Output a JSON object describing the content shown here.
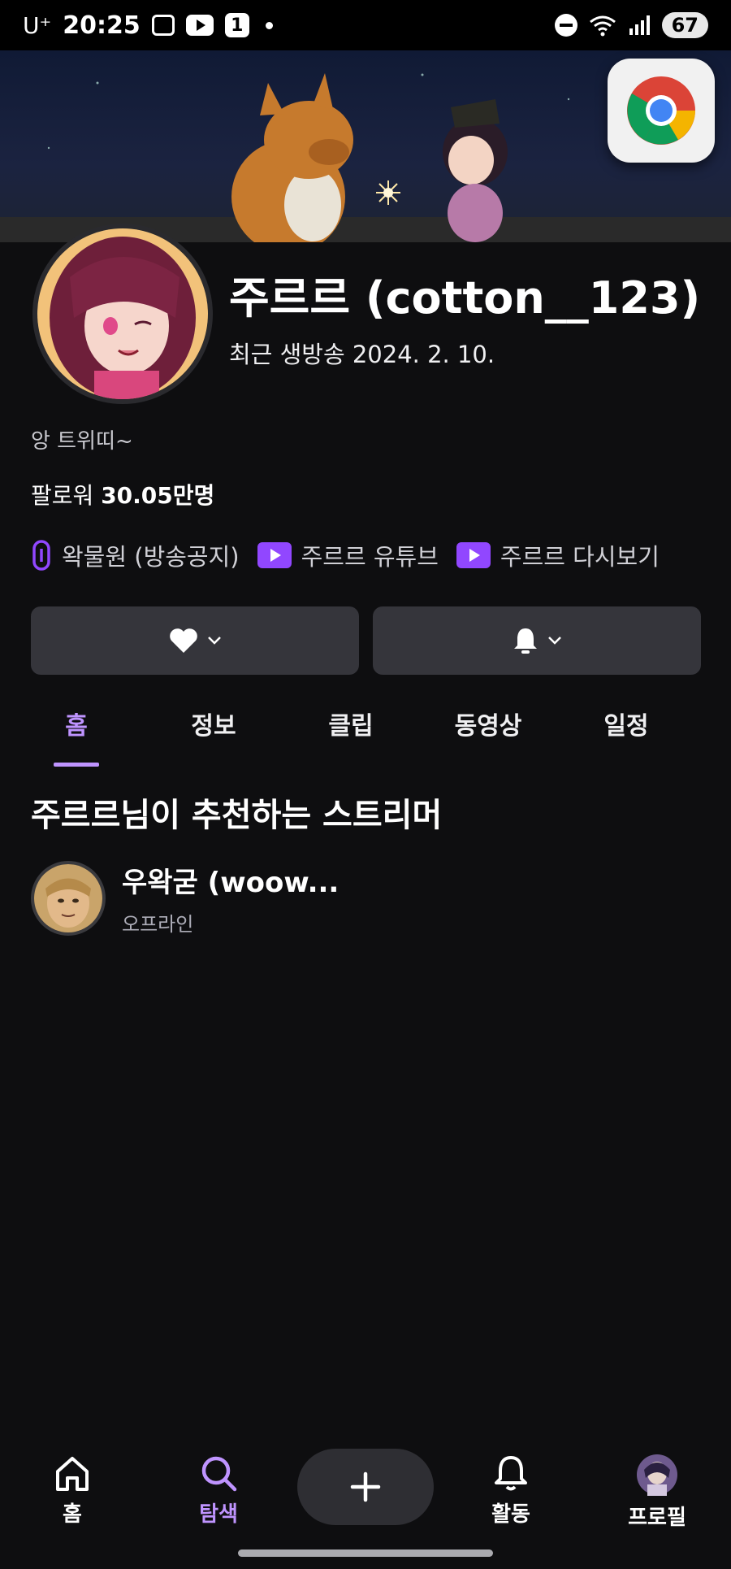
{
  "status_bar": {
    "carrier": "U⁺",
    "time": "20:25",
    "notification_count": "1",
    "battery": "67"
  },
  "profile": {
    "title": "주르르 (cotton__123)",
    "recent_broadcast": "최근 생방송 2024. 2. 10.",
    "bio": "앙 트위띠~",
    "followers_label": "팔로워",
    "followers_count": "30.05만명"
  },
  "links": [
    {
      "label": "왁물원 (방송공지)",
      "icon": "link-icon"
    },
    {
      "label": "주르르 유튜브",
      "icon": "youtube-icon"
    },
    {
      "label": "주르르 다시보기",
      "icon": "youtube-icon"
    }
  ],
  "tabs": [
    {
      "label": "홈",
      "active": true
    },
    {
      "label": "정보",
      "active": false
    },
    {
      "label": "클립",
      "active": false
    },
    {
      "label": "동영상",
      "active": false
    },
    {
      "label": "일정",
      "active": false
    }
  ],
  "recommended": {
    "section_title": "주르르님이 추천하는 스트리머",
    "streamers": [
      {
        "name": "우왁굳 (woow...",
        "status": "오프라인"
      }
    ]
  },
  "bottom_nav": {
    "home": "홈",
    "search": "탐색",
    "activity": "활동",
    "profile": "프로필"
  },
  "colors": {
    "background": "#0e0e10",
    "accent": "#bf94ff",
    "button": "#35353b"
  }
}
